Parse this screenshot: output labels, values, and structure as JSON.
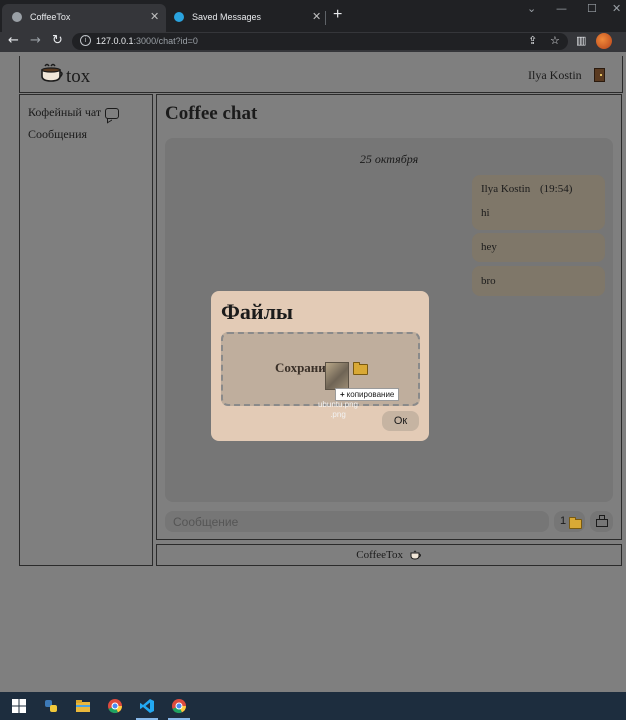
{
  "browser": {
    "tabs": [
      {
        "title": "CoffeeTox",
        "active": true,
        "icon": "globe-icon"
      },
      {
        "title": "Saved Messages",
        "active": false,
        "icon": "telegram-icon"
      }
    ],
    "new_tab": "+",
    "url_host": "127.0.0.1",
    "url_rest": ":3000/chat?id=0",
    "window_controls": [
      "⌄",
      "—",
      "☐",
      "✕"
    ]
  },
  "site": {
    "brand": "tox",
    "user_name": "Ilya Kostin"
  },
  "sidebar": {
    "items": [
      {
        "label": "Кофейный чат"
      },
      {
        "label": "Сообщения"
      }
    ]
  },
  "chat": {
    "title": "Coffee chat",
    "date": "25 октября",
    "messages": [
      {
        "author": "Ilya Kostin",
        "time": "(19:54)",
        "text": "hi"
      },
      {
        "text": "hey"
      },
      {
        "text": "bro"
      }
    ],
    "input_placeholder": "Сообщение",
    "file_count": "1"
  },
  "footer": {
    "label": "CoffeeTox"
  },
  "modal": {
    "title": "Файлы",
    "drop_text": "Сохрани",
    "drag_file_name": "ubuntu.png",
    "drag_file_line2": ".png",
    "copy_tooltip": "копирование",
    "ok_label": "Ок"
  },
  "colors": {
    "overlay_gray": "#7f7f7f",
    "modal_bg": "#e3cbb6",
    "message_bg": "#7f7769",
    "taskbar": "#1d2d3e"
  }
}
